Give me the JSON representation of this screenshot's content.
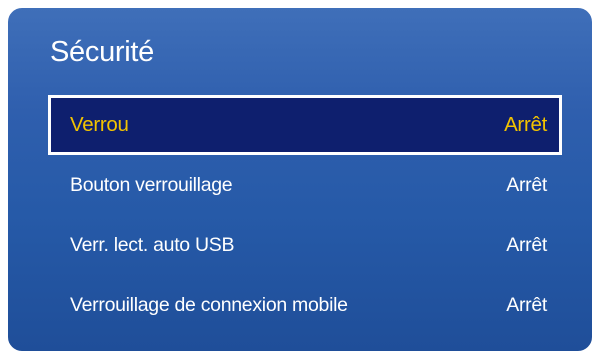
{
  "menu": {
    "title": "Sécurité",
    "items": [
      {
        "label": "Verrou",
        "value": "Arrêt"
      },
      {
        "label": "Bouton verrouillage",
        "value": "Arrêt"
      },
      {
        "label": "Verr. lect. auto USB",
        "value": "Arrêt"
      },
      {
        "label": "Verrouillage de connexion mobile",
        "value": "Arrêt"
      }
    ],
    "selected_index": 0
  },
  "colors": {
    "background_blue": "#2f5fae",
    "selected_bg": "#0e1f6e",
    "selected_text": "#f2c300",
    "text": "#ffffff"
  }
}
